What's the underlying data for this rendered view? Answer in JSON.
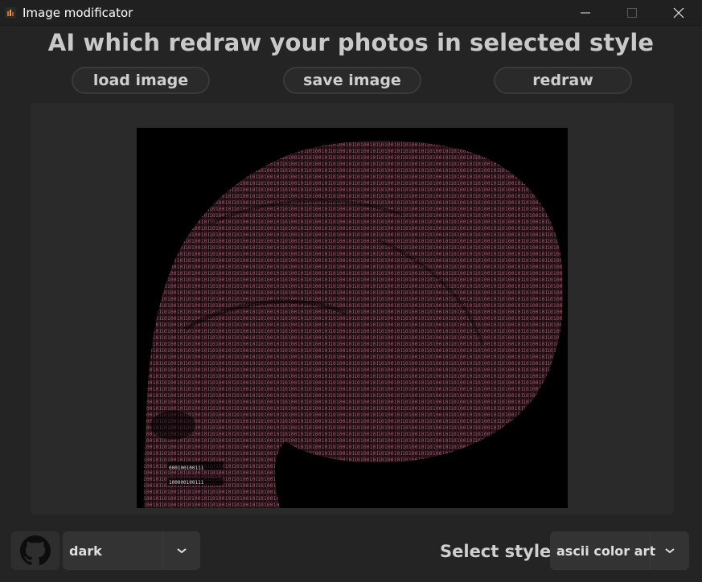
{
  "window": {
    "title": "Image modificator",
    "icon": "app-icon",
    "controls": [
      "minimize-icon",
      "maximize-icon",
      "close-icon"
    ]
  },
  "header": {
    "title": "AI which redraw your photos in selected style"
  },
  "toolbar": {
    "load_label": "load image",
    "save_label": "save image",
    "redraw_label": "redraw"
  },
  "preview": {
    "description_icon": "skull-ascii-image",
    "ascii_chars": "0101101001110100101101001011100101011010"
  },
  "footer": {
    "github_icon": "github-icon",
    "theme": {
      "selected": "dark"
    },
    "style_label": "Select style:",
    "style": {
      "selected": "ascii color art"
    }
  },
  "colors": {
    "background": "#242424",
    "titlebar": "#202020",
    "text": "#c9c9c9",
    "ascii_pink": "#b56b7e"
  }
}
